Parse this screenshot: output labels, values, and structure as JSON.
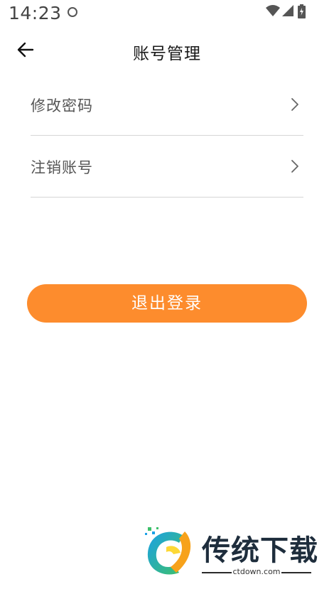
{
  "status_bar": {
    "time": "14:23",
    "icons": [
      "notification-ring-icon",
      "wifi-icon",
      "cell-signal-icon",
      "battery-charging-icon"
    ]
  },
  "header": {
    "back_icon": "arrow-left-icon",
    "title": "账号管理"
  },
  "menu": {
    "items": [
      {
        "label": "修改密码",
        "icon": "chevron-right-icon"
      },
      {
        "label": "注销账号",
        "icon": "chevron-right-icon"
      }
    ]
  },
  "logout": {
    "label": "退出登录",
    "color": "#fd8c2d"
  },
  "watermark": {
    "brand": "传统下载",
    "url": "ctdown.com"
  }
}
